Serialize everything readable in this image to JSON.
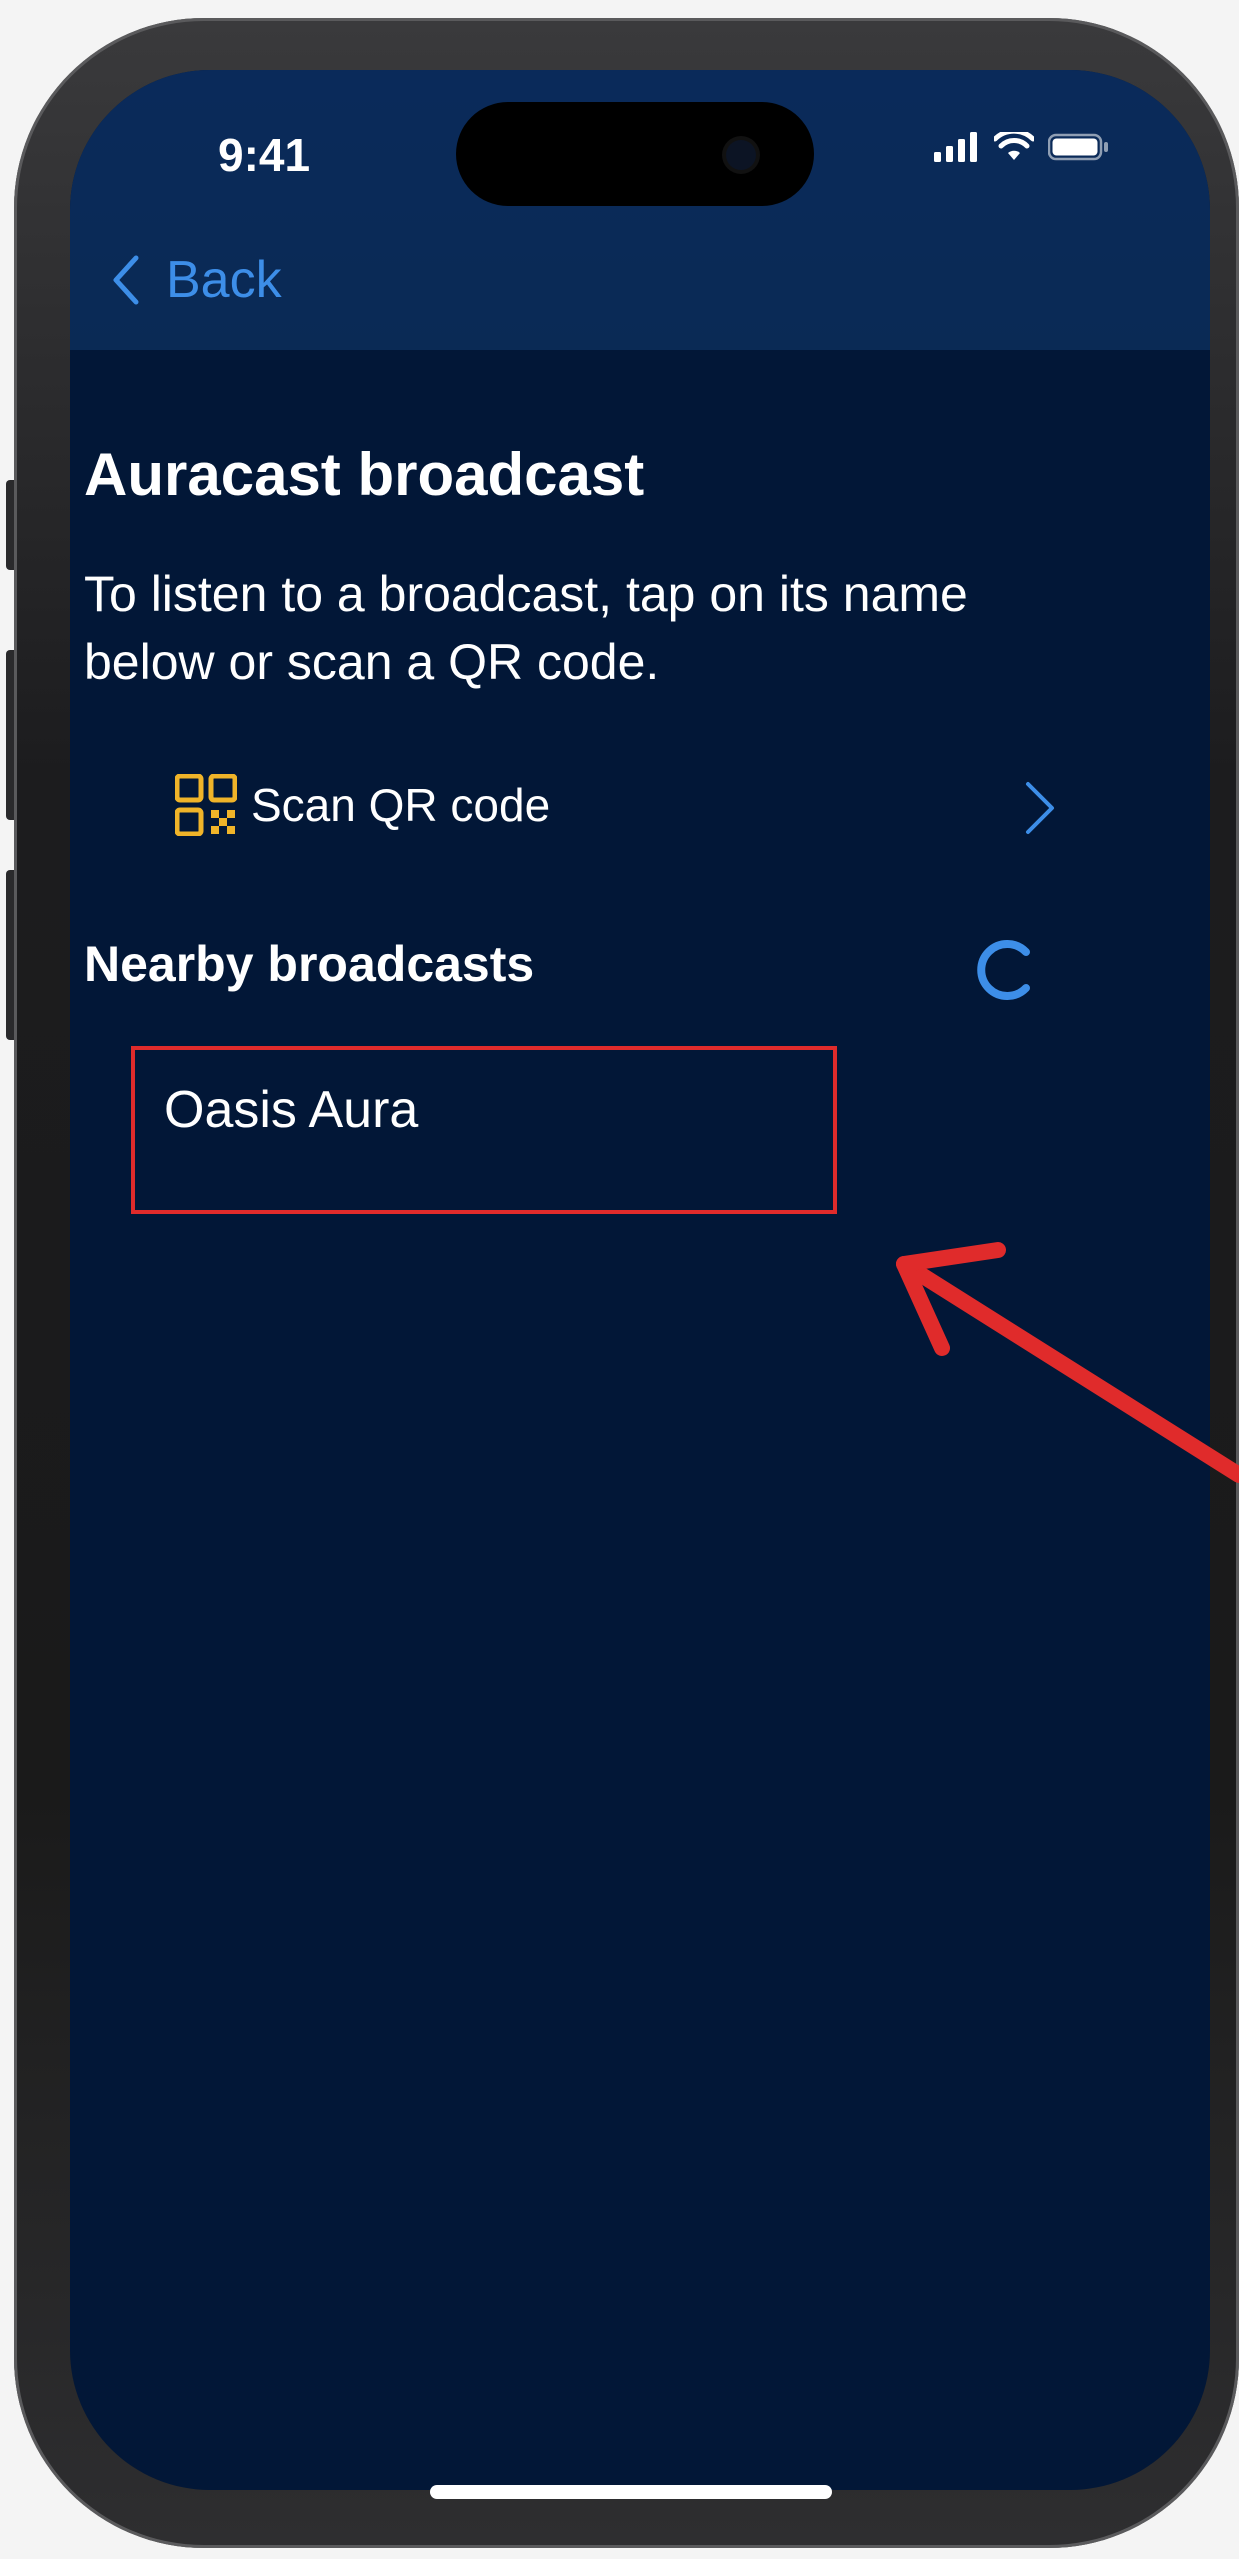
{
  "status_bar": {
    "time": "9:41",
    "icons": [
      "signal-icon",
      "wifi-icon",
      "battery-icon"
    ]
  },
  "nav": {
    "back_label": "Back",
    "back_icon": "chevron-left-icon"
  },
  "page": {
    "title": "Auracast broadcast",
    "description": "To listen to a broadcast, tap on its name below or scan a QR code."
  },
  "scan": {
    "label": "Scan QR code",
    "icon": "qr-code-icon",
    "chevron_icon": "chevron-right-icon"
  },
  "nearby": {
    "title": "Nearby broadcasts",
    "loading_icon": "loading-spinner-icon",
    "items": [
      {
        "label": "Oasis Aura"
      }
    ]
  },
  "annotation": {
    "highlight_color": "#e02b2b",
    "arrow_color": "#e02b2b"
  },
  "colors": {
    "background": "#021737",
    "header": "#0a2a5a",
    "accent": "#3d8ee8",
    "qr_icon": "#f0b429"
  }
}
